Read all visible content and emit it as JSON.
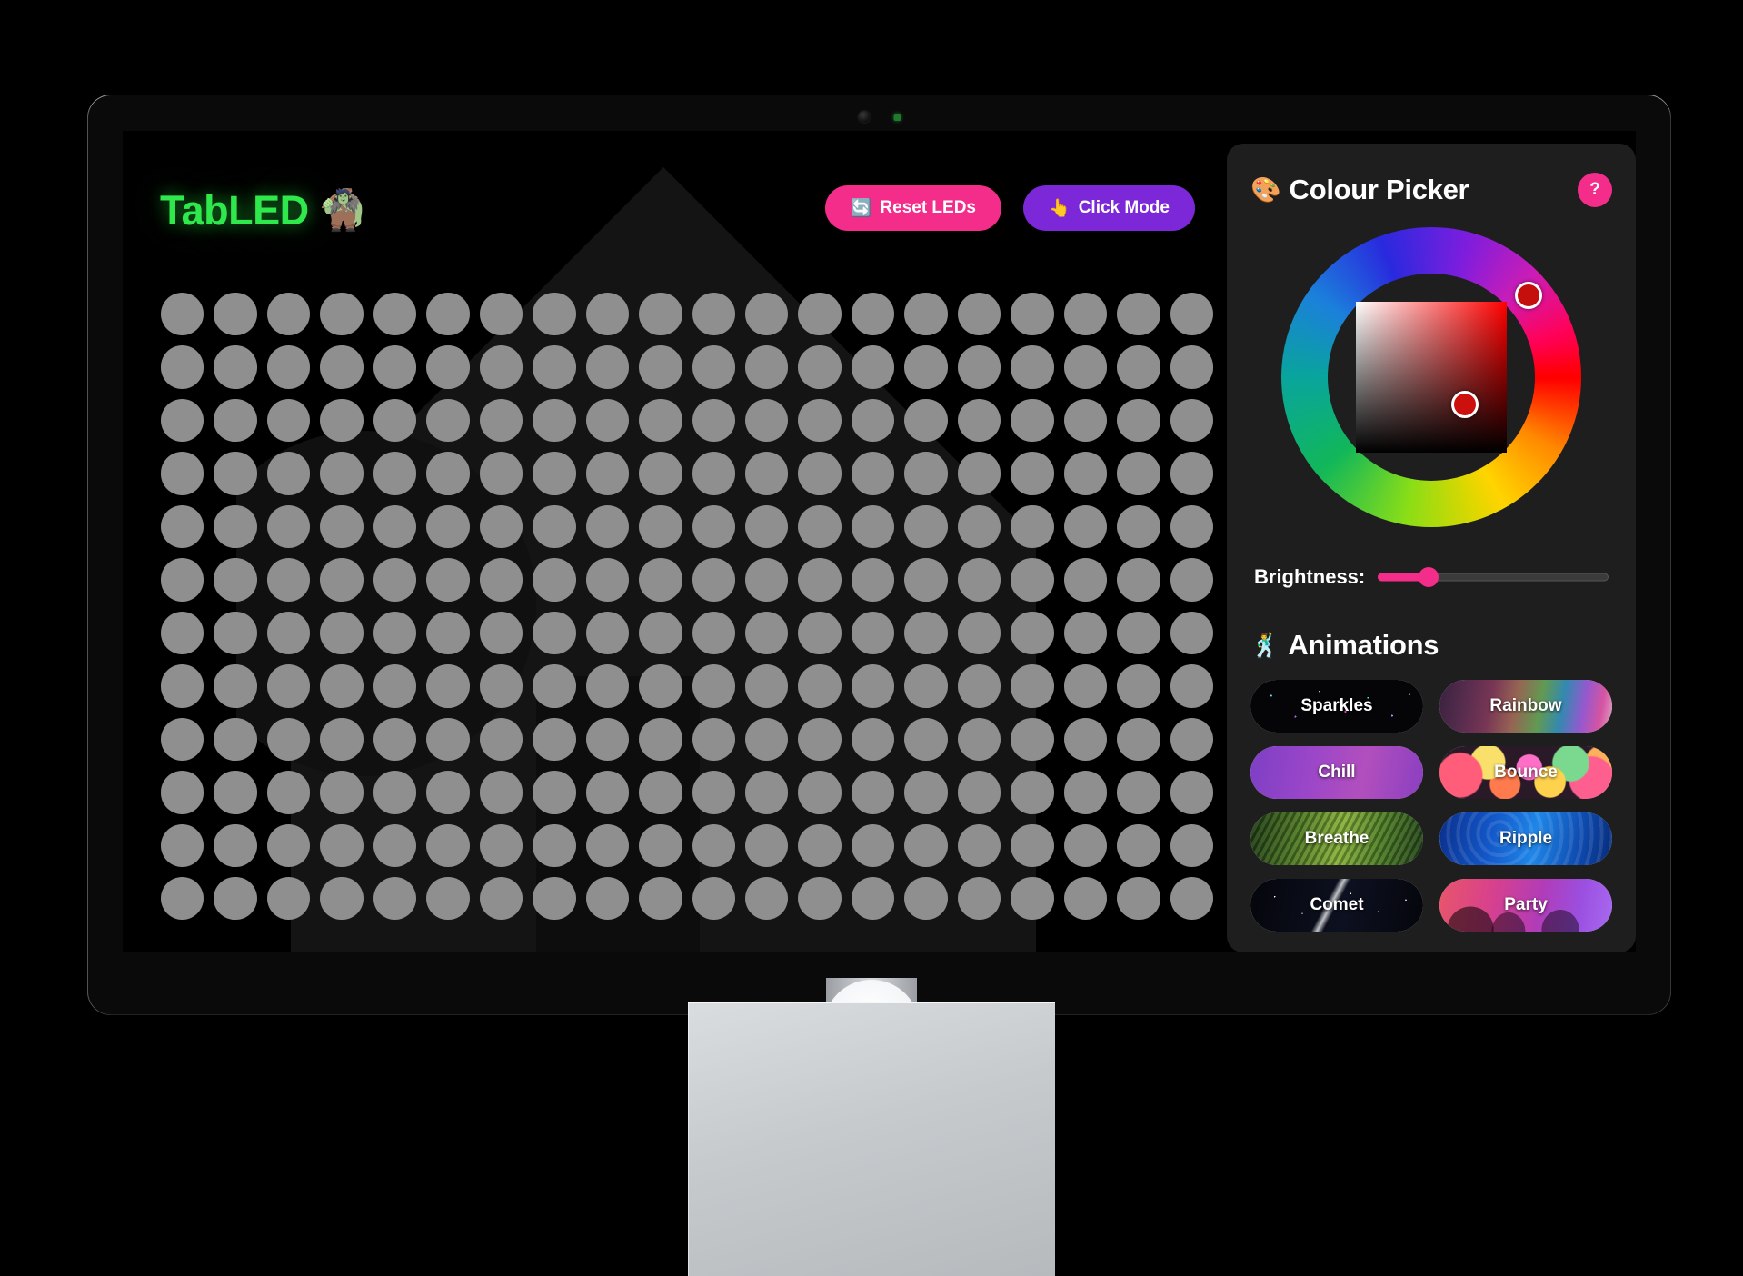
{
  "app": {
    "brand_name": "TabLED",
    "brand_emoji": "🧌"
  },
  "toolbar": {
    "reset_label": "Reset LEDs",
    "reset_emoji": "🔄",
    "click_mode_label": "Click Mode",
    "click_mode_emoji": "👆",
    "reset_color": "#f52d8a",
    "click_mode_color": "#7c28d8"
  },
  "led_grid": {
    "columns": 20,
    "rows": 12,
    "total": 240,
    "off_color": "#8f8f8f"
  },
  "panel": {
    "title": "Colour Picker",
    "title_emoji": "🎨",
    "help_label": "?",
    "help_color": "#f52d8a",
    "picker": {
      "hue_handle_angle_deg": 40,
      "sv_handle_x_pct": 72,
      "sv_handle_y_pct": 68,
      "selected_color": "#cb100e"
    },
    "brightness": {
      "label": "Brightness:",
      "value_pct": 22,
      "fill_color": "#f52d8a"
    },
    "animations": {
      "title": "Animations",
      "title_emoji": "🕺",
      "items": [
        {
          "label": "Sparkles",
          "style": "bg-sparkles"
        },
        {
          "label": "Rainbow",
          "style": "bg-rainbow"
        },
        {
          "label": "Chill",
          "style": "bg-chill"
        },
        {
          "label": "Bounce",
          "style": "bg-bounce"
        },
        {
          "label": "Breathe",
          "style": "bg-breathe"
        },
        {
          "label": "Ripple",
          "style": "bg-ripple"
        },
        {
          "label": "Comet",
          "style": "bg-comet"
        },
        {
          "label": "Party",
          "style": "bg-party"
        }
      ]
    }
  }
}
